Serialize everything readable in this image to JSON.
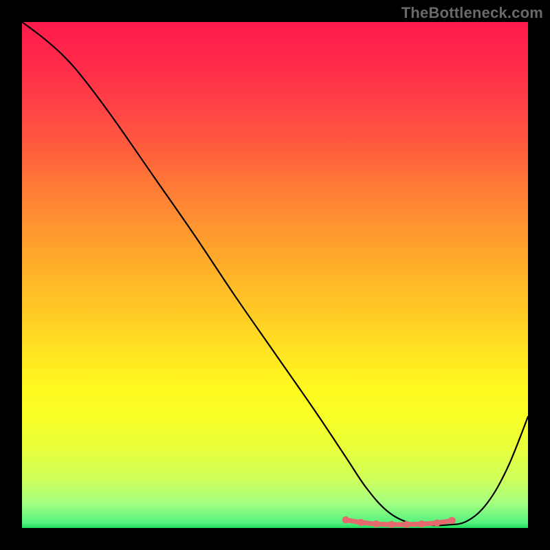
{
  "watermark": "TheBottleneck.com",
  "colors": {
    "page_bg": "#000000",
    "curve_stroke": "#000000",
    "accent_stroke": "#e46a6e",
    "accent_dot_fill": "#e46a6e"
  },
  "chart_data": {
    "type": "line",
    "title": "",
    "xlabel": "",
    "ylabel": "",
    "xlim": [
      0,
      100
    ],
    "ylim": [
      0,
      100
    ],
    "series": [
      {
        "name": "bottleneck-curve",
        "x": [
          0,
          4,
          8,
          12,
          18,
          26,
          34,
          42,
          50,
          58,
          64,
          68,
          72,
          76,
          80,
          84,
          88,
          92,
          96,
          100
        ],
        "values": [
          100,
          97,
          93.5,
          89,
          81,
          69.5,
          58,
          46,
          34.5,
          23,
          14,
          8,
          3.5,
          1.2,
          0.6,
          0.6,
          1.4,
          5,
          12,
          22
        ]
      }
    ],
    "accent_segment": {
      "x": [
        64,
        67,
        70,
        73,
        76,
        79,
        82,
        85
      ],
      "values": [
        1.6,
        1.1,
        0.8,
        0.7,
        0.7,
        0.8,
        1.0,
        1.5
      ]
    },
    "accent_dots": {
      "x": [
        64,
        67,
        70,
        73,
        76,
        79,
        82,
        85
      ],
      "values": [
        1.6,
        1.1,
        0.8,
        0.7,
        0.7,
        0.8,
        1.0,
        1.5
      ]
    }
  }
}
